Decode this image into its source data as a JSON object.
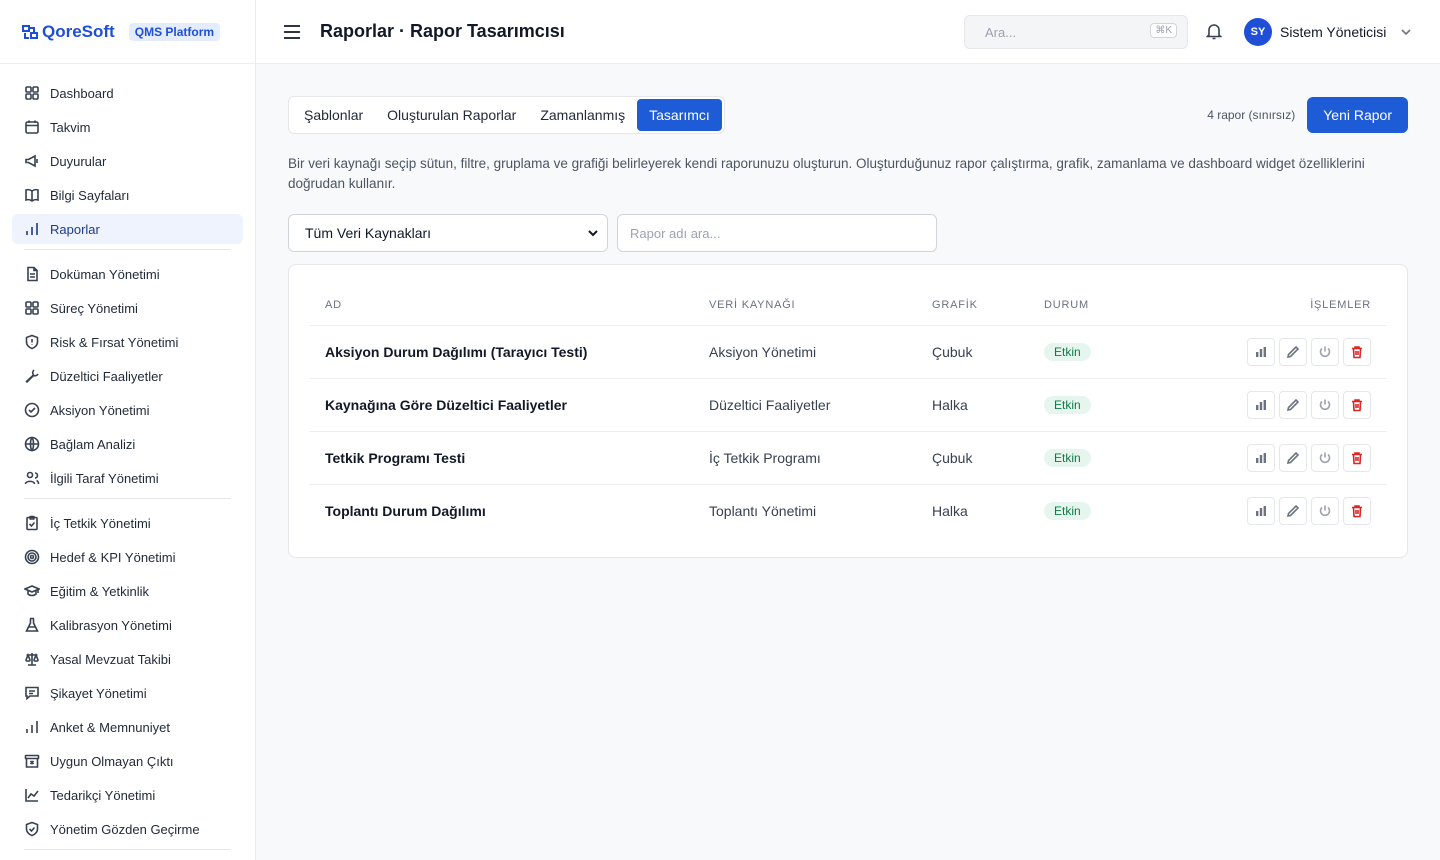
{
  "brand": {
    "name": "QoreSoft",
    "badge": "QMS Platform"
  },
  "header": {
    "title": "Raporlar · Rapor Tasarımcısı",
    "search_placeholder": "Ara...",
    "shortcut": "⌘K",
    "user_initials": "SY",
    "user_name": "Sistem Yöneticisi"
  },
  "sidebar": {
    "group1": [
      {
        "label": "Dashboard",
        "icon": "grid-icon"
      },
      {
        "label": "Takvim",
        "icon": "calendar-icon"
      },
      {
        "label": "Duyurular",
        "icon": "megaphone-icon"
      },
      {
        "label": "Bilgi Sayfaları",
        "icon": "book-icon"
      },
      {
        "label": "Raporlar",
        "icon": "bar-chart-icon",
        "active": true
      }
    ],
    "group2": [
      {
        "label": "Doküman Yönetimi",
        "icon": "document-icon"
      },
      {
        "label": "Süreç Yönetimi",
        "icon": "process-icon"
      },
      {
        "label": "Risk & Fırsat Yönetimi",
        "icon": "shield-icon"
      },
      {
        "label": "Düzeltici Faaliyetler",
        "icon": "wrench-icon"
      },
      {
        "label": "Aksiyon Yönetimi",
        "icon": "check-circle-icon"
      },
      {
        "label": "Bağlam Analizi",
        "icon": "globe-icon"
      },
      {
        "label": "İlgili Taraf Yönetimi",
        "icon": "users-icon"
      }
    ],
    "group3": [
      {
        "label": "İç Tetkik Yönetimi",
        "icon": "clipboard-check-icon"
      },
      {
        "label": "Hedef & KPI Yönetimi",
        "icon": "target-icon"
      },
      {
        "label": "Eğitim & Yetkinlik",
        "icon": "graduation-cap-icon"
      },
      {
        "label": "Kalibrasyon Yönetimi",
        "icon": "flask-icon"
      },
      {
        "label": "Yasal Mevzuat Takibi",
        "icon": "scale-icon"
      },
      {
        "label": "Şikayet Yönetimi",
        "icon": "message-icon"
      },
      {
        "label": "Anket & Memnuniyet",
        "icon": "bar-chart-icon"
      },
      {
        "label": "Uygun Olmayan Çıktı",
        "icon": "archive-x-icon"
      },
      {
        "label": "Tedarikçi Yönetimi",
        "icon": "trend-chart-icon"
      },
      {
        "label": "Yönetim Gözden Geçirme",
        "icon": "shield-check-icon"
      }
    ]
  },
  "tabs": [
    {
      "label": "Şablonlar"
    },
    {
      "label": "Oluşturulan Raporlar"
    },
    {
      "label": "Zamanlanmış"
    },
    {
      "label": "Tasarımcı",
      "active": true
    }
  ],
  "count_note": "4 rapor (sınırsız)",
  "new_report_button": "Yeni Rapor",
  "description": "Bir veri kaynağı seçip sütun, filtre, gruplama ve grafiği belirleyerek kendi raporunuzu oluşturun. Oluşturduğunuz rapor çalıştırma, grafik, zamanlama ve dashboard widget özelliklerini doğrudan kullanır.",
  "filters": {
    "source_selected": "Tüm Veri Kaynakları",
    "name_placeholder": "Rapor adı ara..."
  },
  "table": {
    "headers": {
      "name": "AD",
      "source": "VERİ KAYNAĞI",
      "chart": "GRAFİK",
      "status": "DURUM",
      "ops": "İŞLEMLER"
    },
    "rows": [
      {
        "name": "Aksiyon Durum Dağılımı (Tarayıcı Testi)",
        "source": "Aksiyon Yönetimi",
        "chart": "Çubuk",
        "status": "Etkin"
      },
      {
        "name": "Kaynağına Göre Düzeltici Faaliyetler",
        "source": "Düzeltici Faaliyetler",
        "chart": "Halka",
        "status": "Etkin"
      },
      {
        "name": "Tetkik Programı Testi",
        "source": "İç Tetkik Programı",
        "chart": "Çubuk",
        "status": "Etkin"
      },
      {
        "name": "Toplantı Durum Dağılımı",
        "source": "Toplantı Yönetimi",
        "chart": "Halka",
        "status": "Etkin"
      }
    ]
  },
  "colors": {
    "accent": "#1e5bd6",
    "active_nav_bg": "#eef3fd",
    "status_bg": "#e6f6ee",
    "status_text": "#0f7a45",
    "danger": "#dc2626"
  }
}
